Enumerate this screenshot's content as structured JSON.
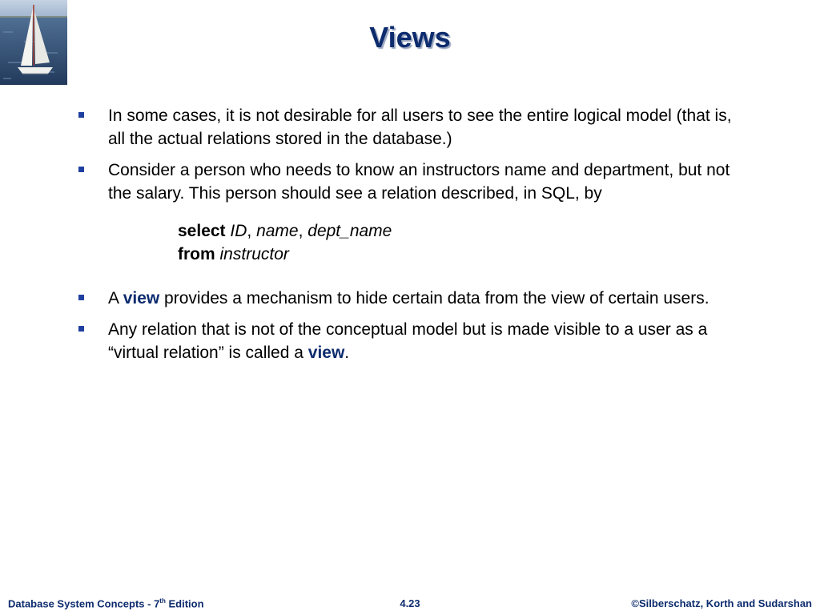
{
  "title": "Views",
  "bullets": [
    {
      "text": "In some cases, it is not desirable for all users to see the entire logical model (that is, all the actual relations stored in the database.)"
    },
    {
      "text": "Consider a person who needs to know an instructors name and department, but not the salary.  This person should see a relation described, in SQL, by"
    },
    {
      "prefix": "A ",
      "keyword": "view",
      "suffix": " provides a mechanism to hide certain data from the view of certain users."
    },
    {
      "prefix": "Any relation that is not of the conceptual model but is made visible to a user as a “virtual relation” is called a ",
      "keyword": "view",
      "suffix": "."
    }
  ],
  "sql": {
    "select_kw": "select",
    "select_cols": [
      {
        "name": "ID",
        "sep": ", "
      },
      {
        "name": "name",
        "sep": ", "
      },
      {
        "name": "dept_name",
        "sep": ""
      }
    ],
    "from_kw": "from",
    "from_table": "instructor"
  },
  "footer": {
    "left": "Database System Concepts - 7",
    "left_sup": "th",
    "left_suffix": " Edition",
    "center": "4.23",
    "right": "©Silberschatz, Korth and Sudarshan"
  },
  "colors": {
    "title": "#0d2c6e",
    "bullet": "#1f3fa0",
    "keyword": "#0d2c6e"
  },
  "icons": {
    "logo": "sailboat-logo",
    "bullet": "square-bullet-icon"
  }
}
